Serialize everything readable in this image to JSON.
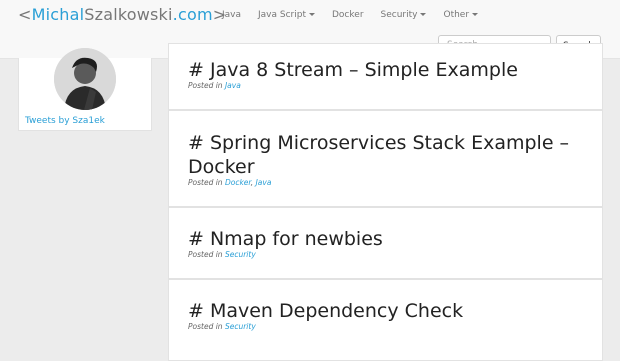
{
  "brand": {
    "open": "<",
    "first": "Michal",
    "last": "Szalkowski",
    "tld": ".com",
    "close": ">"
  },
  "nav": {
    "items": [
      {
        "label": "Java",
        "dropdown": false
      },
      {
        "label": "Java Script",
        "dropdown": true
      },
      {
        "label": "Docker",
        "dropdown": false
      },
      {
        "label": "Security",
        "dropdown": true
      },
      {
        "label": "Other",
        "dropdown": true
      }
    ]
  },
  "search": {
    "placeholder": "Search ...",
    "value": "",
    "button_label": "Search"
  },
  "sidebar": {
    "tweets_link": "Tweets by Sza1ek"
  },
  "posts": [
    {
      "title_lines": [
        "# Java 8 Stream – Simple Example"
      ],
      "posted_in": "Posted in",
      "categories": [
        "Java"
      ]
    },
    {
      "title_lines": [
        "# Spring Microservices Stack Example –",
        "Docker"
      ],
      "posted_in": "Posted in",
      "categories": [
        "Docker",
        "Java"
      ]
    },
    {
      "title_lines": [
        "# Nmap for newbies"
      ],
      "posted_in": "Posted in",
      "categories": [
        "Security"
      ]
    },
    {
      "title_lines": [
        "# Maven Dependency Check"
      ],
      "posted_in": "Posted in",
      "categories": [
        "Security"
      ]
    }
  ],
  "colors": {
    "link": "#2a9fd6",
    "navbar_bg": "#f8f8f8",
    "page_bg": "#ececec",
    "text": "#222222"
  }
}
